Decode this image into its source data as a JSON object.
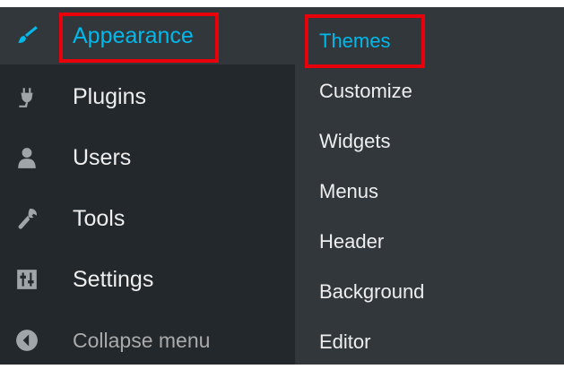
{
  "menu": {
    "items": [
      {
        "label": "Appearance",
        "icon": "paintbrush-icon",
        "current": true
      },
      {
        "label": "Plugins",
        "icon": "plug-icon"
      },
      {
        "label": "Users",
        "icon": "user-icon"
      },
      {
        "label": "Tools",
        "icon": "wrench-icon"
      },
      {
        "label": "Settings",
        "icon": "sliders-icon"
      }
    ],
    "collapse_label": "Collapse menu"
  },
  "submenu": {
    "items": [
      {
        "label": "Themes",
        "current": true
      },
      {
        "label": "Customize"
      },
      {
        "label": "Widgets"
      },
      {
        "label": "Menus"
      },
      {
        "label": "Header"
      },
      {
        "label": "Background"
      },
      {
        "label": "Editor"
      }
    ]
  },
  "colors": {
    "sidebar_bg": "#23282d",
    "submenu_bg": "#32373c",
    "active_text": "#00b9eb",
    "text": "#eeeeee",
    "icon": "#a0a5aa",
    "highlight": "#e8000b"
  }
}
